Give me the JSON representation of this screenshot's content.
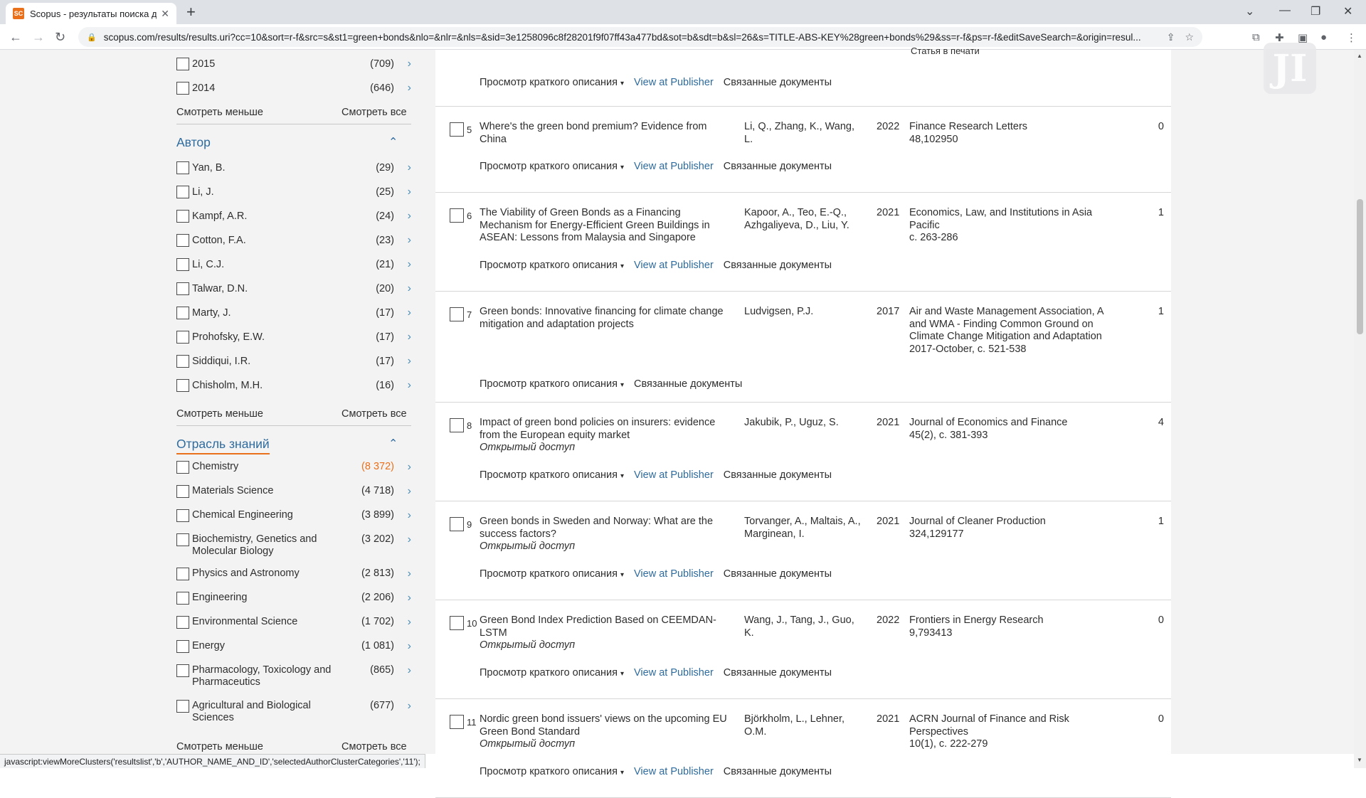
{
  "browser": {
    "tab_title": "Scopus - результаты поиска до…",
    "favicon_text": "SC",
    "new_tab": "+",
    "url": "scopus.com/results/results.uri?cc=10&sort=r-f&src=s&st1=green+bonds&nlo=&nlr=&nls=&sid=3e1258096c8f28201f9f07ff43a477bd&sot=b&sdt=b&sl=26&s=TITLE-ABS-KEY%28green+bonds%29&ss=r-f&ps=r-f&editSaveSearch=&origin=resul...",
    "status_text": "javascript:viewMoreClusters('resultslist','b','AUTHOR_NAME_AND_ID','selectedAuthorClusterCategories','11');"
  },
  "sidebar": {
    "years": [
      {
        "label": "2015",
        "count": "(709)"
      },
      {
        "label": "2014",
        "count": "(646)"
      }
    ],
    "year_less": "Смотреть меньше",
    "year_all": "Смотреть все",
    "author_header": "Автор",
    "authors": [
      {
        "label": "Yan, B.",
        "count": "(29)"
      },
      {
        "label": "Li, J.",
        "count": "(25)"
      },
      {
        "label": "Kampf, A.R.",
        "count": "(24)"
      },
      {
        "label": "Cotton, F.A.",
        "count": "(23)"
      },
      {
        "label": "Li, C.J.",
        "count": "(21)"
      },
      {
        "label": "Talwar, D.N.",
        "count": "(20)"
      },
      {
        "label": "Marty, J.",
        "count": "(17)"
      },
      {
        "label": "Prohofsky, E.W.",
        "count": "(17)"
      },
      {
        "label": "Siddiqui, I.R.",
        "count": "(17)"
      },
      {
        "label": "Chisholm, M.H.",
        "count": "(16)"
      }
    ],
    "author_less": "Смотреть меньше",
    "author_all": "Смотреть все",
    "subject_header": "Отрасль знаний",
    "subjects": [
      {
        "label": "Chemistry",
        "count": "(8 372)"
      },
      {
        "label": "Materials Science",
        "count": "(4 718)"
      },
      {
        "label": "Chemical Engineering",
        "count": "(3 899)"
      },
      {
        "label": "Biochemistry, Genetics and Molecular Biology",
        "count": "(3 202)"
      },
      {
        "label": "Physics and Astronomy",
        "count": "(2 813)"
      },
      {
        "label": "Engineering",
        "count": "(2 206)"
      },
      {
        "label": "Environmental Science",
        "count": "(1 702)"
      },
      {
        "label": "Energy",
        "count": "(1 081)"
      },
      {
        "label": "Pharmacology, Toxicology and Pharmaceutics",
        "count": "(865)"
      },
      {
        "label": "Agricultural and Biological Sciences",
        "count": "(677)"
      }
    ],
    "subject_less": "Смотреть меньше",
    "subject_all": "Смотреть все"
  },
  "results": {
    "top_status": "Статья в печати",
    "labels": {
      "abstract": "Просмотр краткого описания",
      "publisher": "View at Publisher",
      "related": "Связанные документы",
      "open_access": "Открытый доступ"
    },
    "items": [
      {
        "num": "5",
        "title": "Where's the green bond premium? Evidence from China",
        "authors": "Li, Q., Zhang, K., Wang, L.",
        "year": "2022",
        "source": "Finance Research Letters",
        "source_detail": "48,102950",
        "cites": "0"
      },
      {
        "num": "6",
        "title": "The Viability of Green Bonds as a Financing Mechanism for Energy-Efficient Green Buildings in ASEAN: Lessons from Malaysia and Singapore",
        "authors": "Kapoor, A., Teo, E.-Q., Azhgaliyeva, D., Liu, Y.",
        "year": "2021",
        "source": "Economics, Law, and Institutions in Asia Pacific",
        "source_detail": "с. 263-286",
        "cites": "1"
      },
      {
        "num": "7",
        "title": "Green bonds: Innovative financing for climate change mitigation and adaptation projects",
        "authors": "Ludvigsen, P.J.",
        "year": "2017",
        "source": "Air and Waste Management Association, A and WMA - Finding Common Ground on Climate Change Mitigation and Adaptation",
        "source_detail": "2017-October, с. 521-538",
        "cites": "1"
      },
      {
        "num": "8",
        "title": "Impact of green bond policies on insurers: evidence from the European equity market",
        "authors": "Jakubik, P., Uguz, S.",
        "year": "2021",
        "source": "Journal of Economics and Finance",
        "source_detail": "45(2), с. 381-393",
        "cites": "4"
      },
      {
        "num": "9",
        "title": "Green bonds in Sweden and Norway: What are the success factors?",
        "authors": "Torvanger, A., Maltais, A., Marginean, I.",
        "year": "2021",
        "source": "Journal of Cleaner Production",
        "source_detail": "324,129177",
        "cites": "1"
      },
      {
        "num": "10",
        "title": "Green Bond Index Prediction Based on CEEMDAN-LSTM",
        "authors": "Wang, J., Tang, J., Guo, K.",
        "year": "2022",
        "source": "Frontiers in Energy Research",
        "source_detail": "9,793413",
        "cites": "0"
      },
      {
        "num": "11",
        "title": "Nordic green bond issuers' views on the upcoming EU Green Bond Standard",
        "authors": "Björkholm, L., Lehner, O.M.",
        "year": "2021",
        "source": "ACRN Journal of Finance and Risk Perspectives",
        "source_detail": "10(1), с. 222-279",
        "cites": "0"
      }
    ]
  },
  "colors": {
    "accent": "#e9711c",
    "link": "#2e6b9e"
  }
}
